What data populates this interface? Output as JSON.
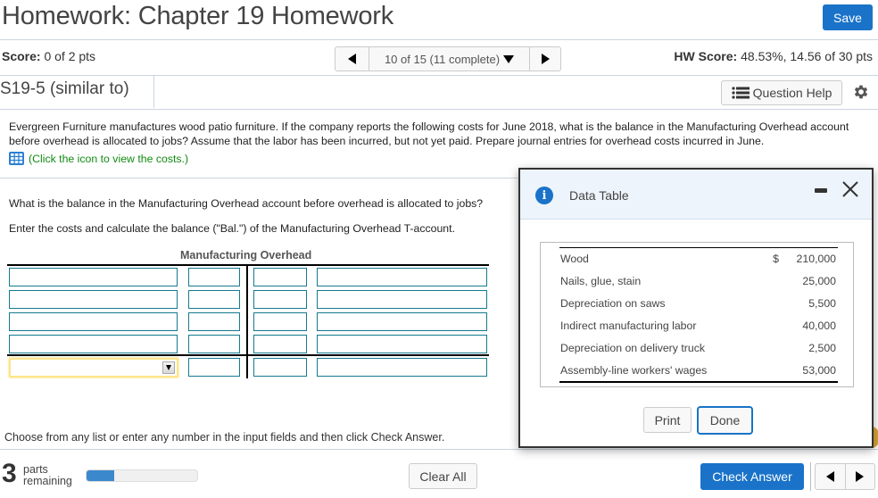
{
  "header": {
    "title": "Homework: Chapter 19 Homework",
    "save_label": "Save"
  },
  "score": {
    "label": "Score:",
    "value": "0 of 2 pts"
  },
  "question_nav": {
    "prev_icon": "triangle-left-icon",
    "current": "10 of 15 (11 complete)",
    "dropdown_icon": "triangle-down-icon",
    "next_icon": "triangle-right-icon"
  },
  "hw_score": {
    "label": "HW Score:",
    "value": "48.53%, 14.56 of 30 pts"
  },
  "question": {
    "id": "S19-5 (similar to)",
    "help_label": "Question Help",
    "help_icon": "list-icon",
    "settings_icon": "gear-icon",
    "problem_text": "Evergreen Furniture manufactures wood patio furniture. If the company reports the following costs for June 2018, what is the balance in the Manufacturing Overhead account before overhead is allocated to jobs? Assume that the labor has been incurred, but not yet paid. Prepare journal entries for overhead costs incurred in June.",
    "cost_link": "(Click the icon to view the costs.)",
    "cost_link_icon": "table-grid-icon",
    "prompt_1": "What is the balance in the Manufacturing Overhead account before overhead is allocated to jobs?",
    "prompt_2": "Enter the costs and calculate the balance (\"Bal.\") of the Manufacturing Overhead T-account.",
    "t_account": {
      "title": "Manufacturing Overhead",
      "rows": [
        {
          "left_label": "",
          "left_amount": "",
          "right_amount": "",
          "right_label": ""
        },
        {
          "left_label": "",
          "left_amount": "",
          "right_amount": "",
          "right_label": ""
        },
        {
          "left_label": "",
          "left_amount": "",
          "right_amount": "",
          "right_label": ""
        },
        {
          "left_label": "",
          "left_amount": "",
          "right_amount": "",
          "right_label": ""
        }
      ],
      "balance_row": {
        "select_value": "",
        "left_amount": "",
        "right_amount": "",
        "right_label": ""
      }
    },
    "instruction": "Choose from any list or enter any number in the input fields and then click Check Answer."
  },
  "footer": {
    "parts_count": "3",
    "parts_label_1": "parts",
    "parts_label_2": "remaining",
    "progress_fraction": 0.25,
    "clear_label": "Clear All",
    "check_label": "Check Answer"
  },
  "dialog": {
    "title": "Data Table",
    "info_icon": "info-icon",
    "info_glyph": "i",
    "minimize_icon": "minimize-icon",
    "close_icon": "close-icon",
    "rows": [
      {
        "label": "Wood",
        "currency": "$",
        "amount": "210,000"
      },
      {
        "label": "Nails, glue, stain",
        "currency": "",
        "amount": "25,000"
      },
      {
        "label": "Depreciation on saws",
        "currency": "",
        "amount": "5,500"
      },
      {
        "label": "Indirect manufacturing labor",
        "currency": "",
        "amount": "40,000"
      },
      {
        "label": "Depreciation on delivery truck",
        "currency": "",
        "amount": "2,500"
      },
      {
        "label": "Assembly-line workers' wages",
        "currency": "",
        "amount": "53,000"
      }
    ],
    "print_label": "Print",
    "done_label": "Done"
  },
  "colors": {
    "accent_blue": "#1a73c8",
    "input_border_teal": "#167a8f",
    "link_green": "#118a11",
    "focus_yellow": "#fde58a"
  }
}
